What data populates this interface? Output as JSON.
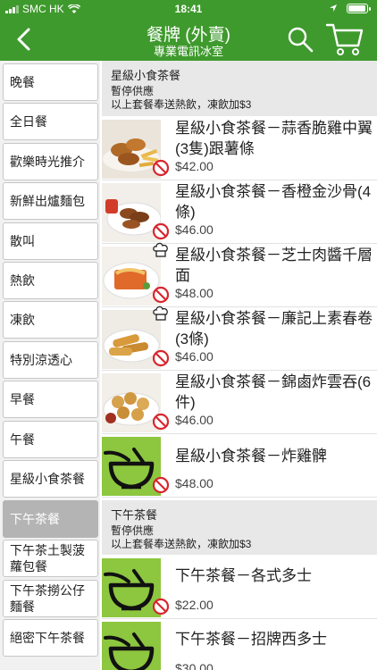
{
  "status": {
    "carrier": "SMC HK",
    "time": "18:41"
  },
  "nav": {
    "title": "餐牌 (外賣)",
    "subtitle": "專業電訊冰室"
  },
  "sidebar": {
    "items": [
      {
        "label": "晚餐"
      },
      {
        "label": "全日餐"
      },
      {
        "label": "歡樂時光推介"
      },
      {
        "label": "新鮮出爐麵包"
      },
      {
        "label": "散叫"
      },
      {
        "label": "熱飲"
      },
      {
        "label": "凍飲"
      },
      {
        "label": "特別涼透心"
      },
      {
        "label": "早餐"
      },
      {
        "label": "午餐"
      },
      {
        "label": "星級小食茶餐"
      },
      {
        "label": "下午茶餐",
        "active": true
      },
      {
        "label": "下午茶土製菠蘿包餐"
      },
      {
        "label": "下午茶撈公仔麵餐"
      },
      {
        "label": "絕密下午茶餐"
      }
    ]
  },
  "sections": [
    {
      "title": "星級小食茶餐",
      "note1": "暫停供應",
      "note2": "以上套餐奉送熱飲，凍飲加$3",
      "items": [
        {
          "name": "星級小食茶餐－蒜香脆雞中翼(3隻)跟薯條",
          "price": "$42.00",
          "image": "photo-fried-wings",
          "chef": false
        },
        {
          "name": "星級小食茶餐－香橙金沙骨(4條)",
          "price": "$46.00",
          "image": "photo-spare-ribs",
          "chef": false
        },
        {
          "name": "星級小食茶餐－芝士肉醬千層面",
          "price": "$48.00",
          "image": "photo-lasagna",
          "chef": true
        },
        {
          "name": "星級小食茶餐－廉記上素春卷(3條)",
          "price": "$46.00",
          "image": "photo-spring-rolls",
          "chef": true
        },
        {
          "name": "星級小食茶餐－錦鹵炸雲吞(6件)",
          "price": "$46.00",
          "image": "photo-wontons",
          "chef": false
        },
        {
          "name": "星級小食茶餐－炸雞髀",
          "price": "$48.00",
          "image": "bowl-placeholder",
          "chef": false
        }
      ]
    },
    {
      "title": "下午茶餐",
      "note1": "暫停供應",
      "note2": "以上套餐奉送熱飲，凍飲加$3",
      "items": [
        {
          "name": "下午茶餐－各式多士",
          "price": "$22.00",
          "image": "bowl-placeholder",
          "chef": false
        },
        {
          "name": "下午茶餐－招牌西多士",
          "price": "$30.00",
          "image": "bowl-placeholder",
          "chef": false
        }
      ]
    }
  ],
  "colors": {
    "brand": "#3f9a2d",
    "placeholder": "#8dc63f",
    "unavailable": "#d8262e",
    "sidebar_active": "#b4b4b4"
  }
}
